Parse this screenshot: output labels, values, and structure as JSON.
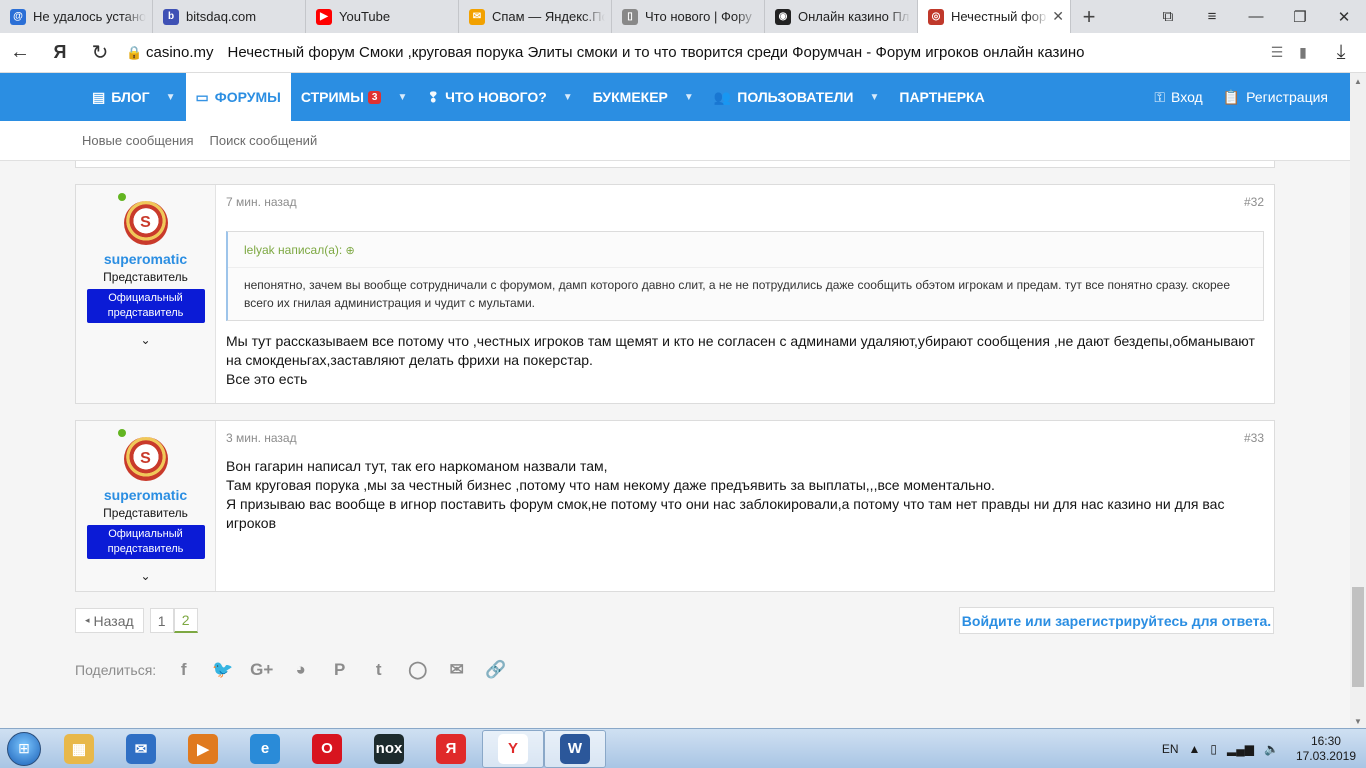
{
  "browser": {
    "tabs": [
      {
        "title": "Не удалось установ",
        "icon": "yandex-mail-icon",
        "color": "#2b6fd6",
        "glyph": "@"
      },
      {
        "title": "bitsdaq.com",
        "icon": "bitsdaq-icon",
        "color": "#3f51b5",
        "glyph": "b"
      },
      {
        "title": "YouTube",
        "icon": "youtube-icon",
        "color": "#ff0000",
        "glyph": "▶"
      },
      {
        "title": "Спам — Яндекс.По",
        "icon": "mail-icon",
        "color": "#f2a100",
        "glyph": "✉"
      },
      {
        "title": "Что нового | Фору",
        "icon": "page-icon",
        "color": "#888888",
        "glyph": "▯"
      },
      {
        "title": "Онлайн казино Пл",
        "icon": "casino-icon",
        "color": "#222222",
        "glyph": "◉"
      },
      {
        "title": "Нечестный фор",
        "icon": "forum-icon",
        "color": "#c0392b",
        "glyph": "◎",
        "active": true
      }
    ],
    "new_tab": "+",
    "url_domain": "casino.my",
    "url_title": "Нечестный форум Смоки ,круговая порука Элиты смоки и то что творится среди Форумчан - Форум игроков онлайн казино"
  },
  "site": {
    "nav": [
      {
        "label": "БЛОГ",
        "icon": "blog-icon",
        "glyph": "▤",
        "caret": true
      },
      {
        "label": "ФОРУМЫ",
        "icon": "forum-icon",
        "glyph": "▭",
        "active": true
      },
      {
        "label": "СТРИМЫ",
        "icon": "",
        "glyph": "",
        "badge": "3",
        "caret": true
      },
      {
        "label": "ЧТО НОВОГО?",
        "icon": "whats-new-icon",
        "glyph": "❢",
        "caret": true
      },
      {
        "label": "БУКМЕКЕР",
        "icon": "",
        "glyph": "",
        "caret": true
      },
      {
        "label": "ПОЛЬЗОВАТЕЛИ",
        "icon": "users-icon",
        "glyph": "👥",
        "caret": true
      },
      {
        "label": "ПАРТНЕРКА",
        "icon": "",
        "glyph": ""
      }
    ],
    "login": "Вход",
    "register": "Регистрация",
    "subnav": [
      "Новые сообщения",
      "Поиск сообщений"
    ]
  },
  "posts": [
    {
      "time": "7 мин. назад",
      "num": "#32",
      "user": "superomatic",
      "role": "Представитель",
      "banner": "Официальный представитель",
      "quote_author": "lelyak написал(а):",
      "quote_text": "непонятно, зачем вы вообще сотрудничали с форумом, дамп которого давно слит, а не не потрудились даже сообщить обэтом игрокам и предам. тут все понятно сразу. скорее всего их гнилая администрация и чудит с мультами.",
      "lines": [
        "Мы тут рассказываем все потому что ,честных игроков там щемят и кто не согласен с админами удаляют,убирают сообщения ,не дают бездепы,обманывают на смокденьгах,заставляют делать фрихи на покерстар.",
        "Все это есть"
      ]
    },
    {
      "time": "3 мин. назад",
      "num": "#33",
      "user": "superomatic",
      "role": "Представитель",
      "banner": "Официальный представитель",
      "lines": [
        "Вон гагарин написал тут, так его наркоманом назвали там,",
        "Там круговая порука ,мы за честный бизнес ,потому что нам некому даже предъявить за выплаты,,,все моментально.",
        "Я призываю вас вообще в игнор поставить форум смок,не потому что они нас заблокировали,а потому что там нет правды ни для нас казино ни для вас игроков"
      ]
    }
  ],
  "pager": {
    "prev": "Назад",
    "pages": [
      "1",
      "2"
    ],
    "current": "2"
  },
  "reply_prompt": "Войдите или зарегистрируйтесь для ответа.",
  "share_label": "Поделиться:",
  "share_icons": [
    {
      "name": "facebook-icon",
      "glyph": "f"
    },
    {
      "name": "twitter-icon",
      "glyph": "🐦"
    },
    {
      "name": "google-plus-icon",
      "glyph": "G+"
    },
    {
      "name": "reddit-icon",
      "glyph": "◕"
    },
    {
      "name": "pinterest-icon",
      "glyph": "P"
    },
    {
      "name": "tumblr-icon",
      "glyph": "t"
    },
    {
      "name": "whatsapp-icon",
      "glyph": "◯"
    },
    {
      "name": "email-icon",
      "glyph": "✉"
    },
    {
      "name": "link-icon",
      "glyph": "🔗"
    }
  ],
  "taskbar": {
    "apps": [
      {
        "name": "explorer-icon",
        "color": "#e8b84a",
        "glyph": "▦"
      },
      {
        "name": "outlook-icon",
        "color": "#2f6fc4",
        "glyph": "✉"
      },
      {
        "name": "media-player-icon",
        "color": "#e07a1f",
        "glyph": "▶"
      },
      {
        "name": "internet-explorer-icon",
        "color": "#2a8bd8",
        "glyph": "e"
      },
      {
        "name": "opera-icon",
        "color": "#d8141f",
        "glyph": "O"
      },
      {
        "name": "nox-icon",
        "color": "#1d2b2d",
        "glyph": "nox"
      },
      {
        "name": "yandex-icon",
        "color": "#e02a2a",
        "glyph": "Я"
      },
      {
        "name": "yandex-browser-icon",
        "color": "#ffffff",
        "glyph": "Y",
        "fg": "#e02a2a",
        "sel": true
      },
      {
        "name": "word-icon",
        "color": "#2b579a",
        "glyph": "W",
        "sel": true
      }
    ],
    "lang": "EN",
    "time": "16:30",
    "date": "17.03.2019"
  }
}
